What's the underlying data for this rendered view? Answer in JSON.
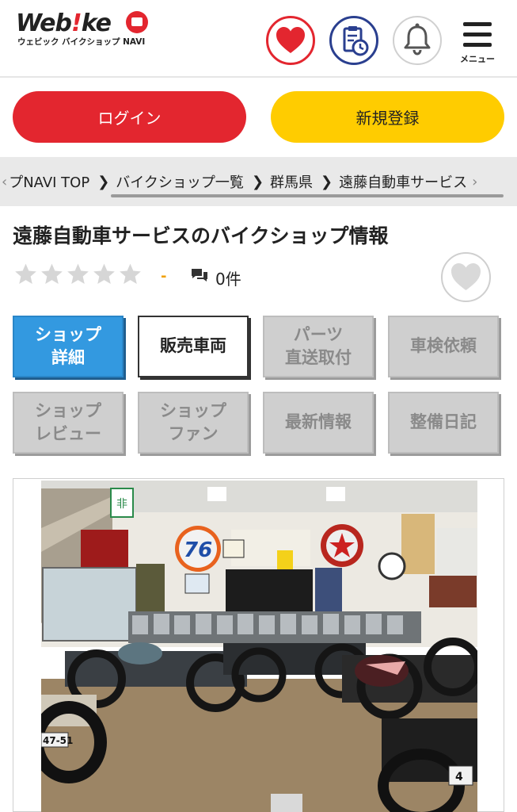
{
  "header": {
    "logo_main_a": "Web",
    "logo_main_ex": "!",
    "logo_main_b": "ke",
    "logo_sub": "ウェビック バイクショップ NAVI",
    "favorites_icon": "heart-icon",
    "history_icon": "clipboard-clock-icon",
    "notifications_icon": "bell-icon",
    "menu_icon": "hamburger-icon",
    "menu_label": "メニュー"
  },
  "auth": {
    "login_label": "ログイン",
    "signup_label": "新規登録"
  },
  "breadcrumb": {
    "items": [
      "プNAVI TOP",
      "バイクショップ一覧",
      "群馬県",
      "遠藤自動車サービス"
    ]
  },
  "shop": {
    "title": "遠藤自動車サービスのバイクショップ情報",
    "rating_value": "-",
    "rating_stars_filled": 0,
    "rating_stars_total": 5,
    "review_count": "0件",
    "review_icon": "speech-bubbles-icon",
    "like_icon": "heart-icon"
  },
  "tabs": [
    {
      "label": "ショップ\n詳細",
      "state": "active"
    },
    {
      "label": "販売車両",
      "state": "normal"
    },
    {
      "label": "パーツ\n直送取付",
      "state": "disabled"
    },
    {
      "label": "車検依頼",
      "state": "disabled"
    },
    {
      "label": "ショップ\nレビュー",
      "state": "disabled"
    },
    {
      "label": "ショップ\nファン",
      "state": "disabled"
    },
    {
      "label": "最新情報",
      "state": "disabled"
    },
    {
      "label": "整備日記",
      "state": "disabled"
    }
  ],
  "photo": {
    "sign_76": "76",
    "exit_sign": "非",
    "plate_left": "47-51",
    "plate_right": "4"
  },
  "colors": {
    "brand_red": "#e3262f",
    "brand_yellow": "#ffcc00",
    "brand_navy": "#2a3f8f",
    "tab_active": "#3399e0",
    "tab_disabled": "#cfcfcf",
    "star_empty": "#d6d6d6"
  }
}
